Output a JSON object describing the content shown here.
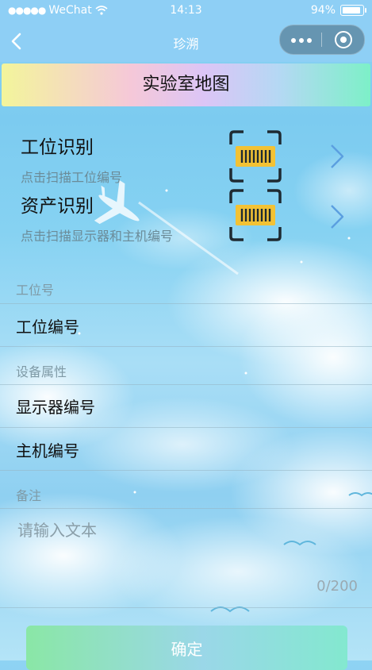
{
  "status_bar": {
    "carrier": "WeChat",
    "time": "14:13",
    "battery": "94%"
  },
  "nav": {
    "title": "珍溯"
  },
  "header": {
    "title": "实验室地图"
  },
  "scan": [
    {
      "label": "工位识别",
      "hint": "点击扫描工位编号"
    },
    {
      "label": "资产识别",
      "hint": "点击扫描显示器和主机编号"
    }
  ],
  "form": {
    "station_section": "工位号",
    "station_field": "工位编号",
    "device_section": "设备属性",
    "monitor_field": "显示器编号",
    "host_field": "主机编号",
    "notes_section": "备注",
    "notes_placeholder": "请输入文本",
    "counter": "0/200"
  },
  "confirm_label": "确定",
  "colors": {
    "nav_bg": "#8ecff5",
    "accent_icon": "#f3c234",
    "chevron": "#5b9fe0"
  }
}
